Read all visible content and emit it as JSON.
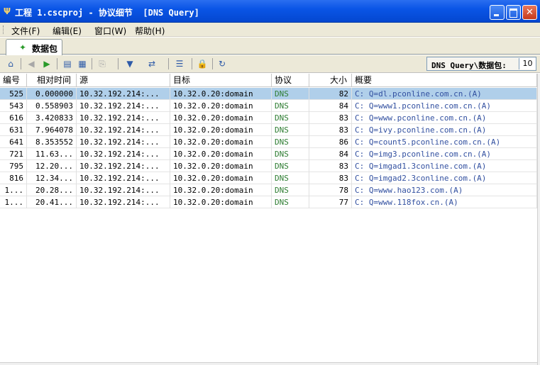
{
  "window": {
    "title": "工程 1.cscproj - 协议细节  [DNS Query]",
    "controls": {
      "minimize": "_",
      "maximize": "□",
      "close": "✕"
    }
  },
  "menu": [
    {
      "label": "文件(F)"
    },
    {
      "label": "编辑(E)"
    },
    {
      "label": "窗口(W)"
    },
    {
      "label": "帮助(H)"
    }
  ],
  "tab": {
    "label": "数据包",
    "icon": "packets-icon"
  },
  "toolbar": {
    "buttons": [
      {
        "name": "home-icon",
        "glyph": "⌂",
        "enabled": true
      },
      {
        "name": "back-icon",
        "glyph": "◀",
        "enabled": false
      },
      {
        "name": "forward-icon",
        "glyph": "▶",
        "enabled": true
      },
      {
        "name": "page-icon",
        "glyph": "▤",
        "enabled": true
      },
      {
        "name": "decode-icon",
        "glyph": "▦",
        "enabled": true
      },
      {
        "name": "copy-icon",
        "glyph": "⎘",
        "enabled": false
      },
      {
        "name": "filter-icon",
        "glyph": "▼",
        "enabled": true
      },
      {
        "name": "export-icon",
        "glyph": "⇄",
        "enabled": true
      },
      {
        "name": "columns-icon",
        "glyph": "☰",
        "enabled": true
      },
      {
        "name": "lock-icon",
        "glyph": "🔒",
        "enabled": true
      },
      {
        "name": "refresh-icon",
        "glyph": "↻",
        "enabled": true
      }
    ],
    "counter_label": "DNS Query\\数据包:",
    "counter_value": "10"
  },
  "table": {
    "columns": [
      "编号",
      "相对时间",
      "源",
      "目标",
      "协议",
      "大小",
      "概要"
    ],
    "rows": [
      {
        "no": "525",
        "time": "0.000000",
        "src": "10.32.192.214:...",
        "dst": "10.32.0.20:domain",
        "proto": "DNS",
        "size": "82",
        "summary": "C: Q=dl.pconline.com.cn.(A)"
      },
      {
        "no": "543",
        "time": "0.558903",
        "src": "10.32.192.214:...",
        "dst": "10.32.0.20:domain",
        "proto": "DNS",
        "size": "84",
        "summary": "C: Q=www1.pconline.com.cn.(A)"
      },
      {
        "no": "616",
        "time": "3.420833",
        "src": "10.32.192.214:...",
        "dst": "10.32.0.20:domain",
        "proto": "DNS",
        "size": "83",
        "summary": "C: Q=www.pconline.com.cn.(A)"
      },
      {
        "no": "631",
        "time": "7.964078",
        "src": "10.32.192.214:...",
        "dst": "10.32.0.20:domain",
        "proto": "DNS",
        "size": "83",
        "summary": "C: Q=ivy.pconline.com.cn.(A)"
      },
      {
        "no": "641",
        "time": "8.353552",
        "src": "10.32.192.214:...",
        "dst": "10.32.0.20:domain",
        "proto": "DNS",
        "size": "86",
        "summary": "C: Q=count5.pconline.com.cn.(A)"
      },
      {
        "no": "721",
        "time": "11.63...",
        "src": "10.32.192.214:...",
        "dst": "10.32.0.20:domain",
        "proto": "DNS",
        "size": "84",
        "summary": "C: Q=img3.pconline.com.cn.(A)"
      },
      {
        "no": "795",
        "time": "12.20...",
        "src": "10.32.192.214:...",
        "dst": "10.32.0.20:domain",
        "proto": "DNS",
        "size": "83",
        "summary": "C: Q=imgad1.3conline.com.(A)"
      },
      {
        "no": "816",
        "time": "12.34...",
        "src": "10.32.192.214:...",
        "dst": "10.32.0.20:domain",
        "proto": "DNS",
        "size": "83",
        "summary": "C: Q=imgad2.3conline.com.(A)"
      },
      {
        "no": "1...",
        "time": "20.28...",
        "src": "10.32.192.214:...",
        "dst": "10.32.0.20:domain",
        "proto": "DNS",
        "size": "78",
        "summary": "C: Q=www.hao123.com.(A)"
      },
      {
        "no": "1...",
        "time": "20.41...",
        "src": "10.32.192.214:...",
        "dst": "10.32.0.20:domain",
        "proto": "DNS",
        "size": "77",
        "summary": "C: Q=www.118fox.cn.(A)"
      }
    ],
    "selected_row": 0
  },
  "colors": {
    "titlebar": "#0a55e6",
    "selection": "#b0cfea",
    "protocol_text": "#2e7d32",
    "summary_text": "#3250a0"
  }
}
